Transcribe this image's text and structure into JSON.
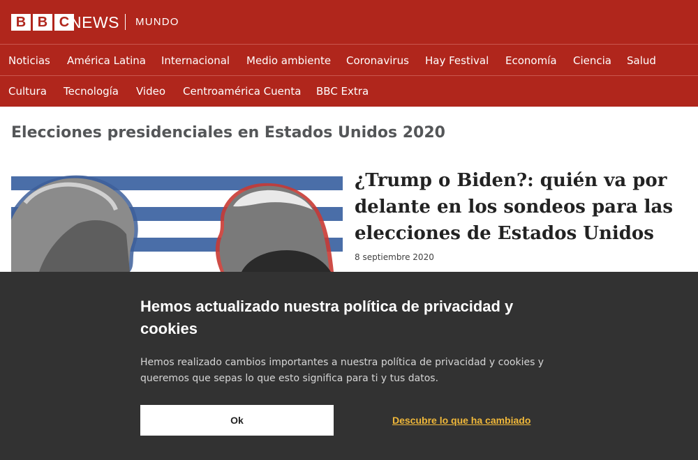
{
  "brand": {
    "letters": [
      "B",
      "B",
      "C"
    ],
    "news": "NEWS",
    "edition": "MUNDO"
  },
  "nav": {
    "row1": [
      "Noticias",
      "América Latina",
      "Internacional",
      "Medio ambiente",
      "Coronavirus",
      "Hay Festival",
      "Economía",
      "Ciencia",
      "Salud"
    ],
    "row2": [
      "Cultura",
      "Tecnología",
      "Video",
      "Centroamérica Cuenta",
      "BBC Extra"
    ]
  },
  "section": {
    "title": "Elecciones presidenciales en Estados Unidos 2020"
  },
  "article": {
    "headline": "¿Trump o Biden?: quién va por delante en los sondeos para las elecciones de Estados Unidos",
    "date": "8 septiembre 2020"
  },
  "cookie_banner": {
    "title": "Hemos actualizado nuestra política de privacidad y cookies",
    "text": "Hemos realizado cambios importantes a nuestra política de privacidad y cookies y queremos que sepas lo que esto significa para ti y tus datos.",
    "ok_label": "Ok",
    "learn_more_label": "Descubre lo que ha cambiado"
  },
  "colors": {
    "brand_red": "#b0261c",
    "banner_bg": "#323232",
    "link_yellow": "#f0b83a"
  }
}
